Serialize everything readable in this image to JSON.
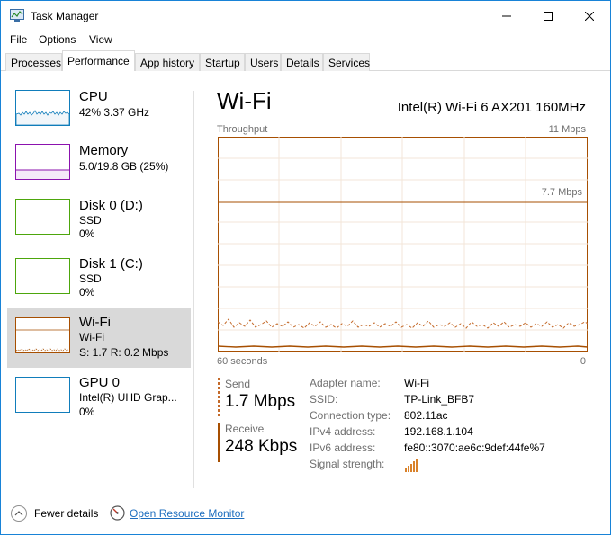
{
  "window": {
    "title": "Task Manager",
    "minimize_glyph": "—",
    "maximize_glyph": "☐",
    "close_glyph": "✕"
  },
  "menu": [
    "File",
    "Options",
    "View"
  ],
  "tabs": [
    {
      "label": "Processes",
      "active": false
    },
    {
      "label": "Performance",
      "active": true
    },
    {
      "label": "App history",
      "active": false
    },
    {
      "label": "Startup",
      "active": false
    },
    {
      "label": "Users",
      "active": false
    },
    {
      "label": "Details",
      "active": false
    },
    {
      "label": "Services",
      "active": false
    }
  ],
  "sidebar": {
    "items": [
      {
        "title": "CPU",
        "line1": "42%  3.37 GHz",
        "line2": "",
        "color": "#117dbb",
        "selected": false
      },
      {
        "title": "Memory",
        "line1": "5.0/19.8 GB (25%)",
        "line2": "",
        "color": "#8b12ae",
        "selected": false
      },
      {
        "title": "Disk 0 (D:)",
        "line1": "SSD",
        "line2": "0%",
        "color": "#4da60c",
        "selected": false
      },
      {
        "title": "Disk 1 (C:)",
        "line1": "SSD",
        "line2": "0%",
        "color": "#4da60c",
        "selected": false
      },
      {
        "title": "Wi-Fi",
        "line1": "Wi-Fi",
        "line2": "S: 1.7  R: 0.2 Mbps",
        "color": "#a74f01",
        "selected": true
      },
      {
        "title": "GPU 0",
        "line1": "Intel(R) UHD Grap...",
        "line2": "0%",
        "color": "#117dbb",
        "selected": false
      }
    ]
  },
  "main": {
    "title": "Wi-Fi",
    "adapter_model": "Intel(R) Wi-Fi 6 AX201 160MHz",
    "throughput_label": "Throughput",
    "max_label": "11 Mbps",
    "line_label": "7.7 Mbps",
    "time_label": "60 seconds",
    "zero_label": "0",
    "accent_color": "#a74f01",
    "send": {
      "label": "Send",
      "value": "1.7 Mbps"
    },
    "receive": {
      "label": "Receive",
      "value": "248 Kbps"
    },
    "details": [
      {
        "key": "Adapter name:",
        "value": "Wi-Fi"
      },
      {
        "key": "SSID:",
        "value": "TP-Link_BFB7"
      },
      {
        "key": "Connection type:",
        "value": "802.11ac"
      },
      {
        "key": "IPv4 address:",
        "value": "192.168.1.104"
      },
      {
        "key": "IPv6 address:",
        "value": "fe80::3070:ae6c:9def:44fe%7"
      },
      {
        "key": "Signal strength:",
        "value": ""
      }
    ]
  },
  "footer": {
    "fewer_details": "Fewer details",
    "open_resource_monitor": "Open Resource Monitor"
  }
}
